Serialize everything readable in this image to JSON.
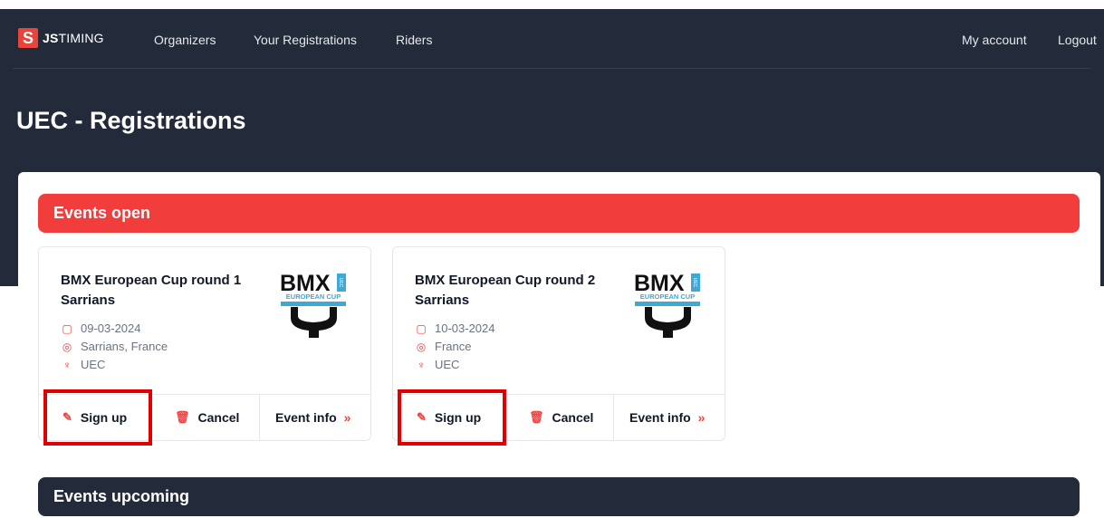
{
  "nav": {
    "logo_letter": "S",
    "logo_text_bold": "JS",
    "logo_text": "TIMING",
    "links": [
      "Organizers",
      "Your Registrations",
      "Riders"
    ],
    "my_account": "My account",
    "logout": "Logout"
  },
  "page": {
    "title": "UEC - Registrations"
  },
  "sections": {
    "open": "Events open",
    "upcoming": "Events upcoming"
  },
  "cards": [
    {
      "title": "BMX European Cup round 1 Sarrians",
      "date": "09-03-2024",
      "location": "Sarrians, France",
      "organizer": "UEC",
      "signup": "Sign up",
      "cancel": "Cancel",
      "info": "Event info",
      "logo": {
        "main": "BMX",
        "side": "UEC",
        "sub": "EUROPEAN CUP"
      }
    },
    {
      "title": "BMX European Cup round 2 Sarrians",
      "date": "10-03-2024",
      "location": "France",
      "organizer": "UEC",
      "signup": "Sign up",
      "cancel": "Cancel",
      "info": "Event info",
      "logo": {
        "main": "BMX",
        "side": "UEC",
        "sub": "EUROPEAN CUP"
      }
    }
  ],
  "icons": {
    "calendar": "calendar-icon",
    "location": "location-pin-icon",
    "trophy": "trophy-icon",
    "edit": "edit-icon",
    "trash": "trash-icon",
    "chevrons": "double-chevron-right-icon"
  },
  "colors": {
    "header_bg": "#232b3a",
    "accent_red": "#f23d3d",
    "highlight_red": "#e00000",
    "logo_blue": "#3fa9d6"
  }
}
